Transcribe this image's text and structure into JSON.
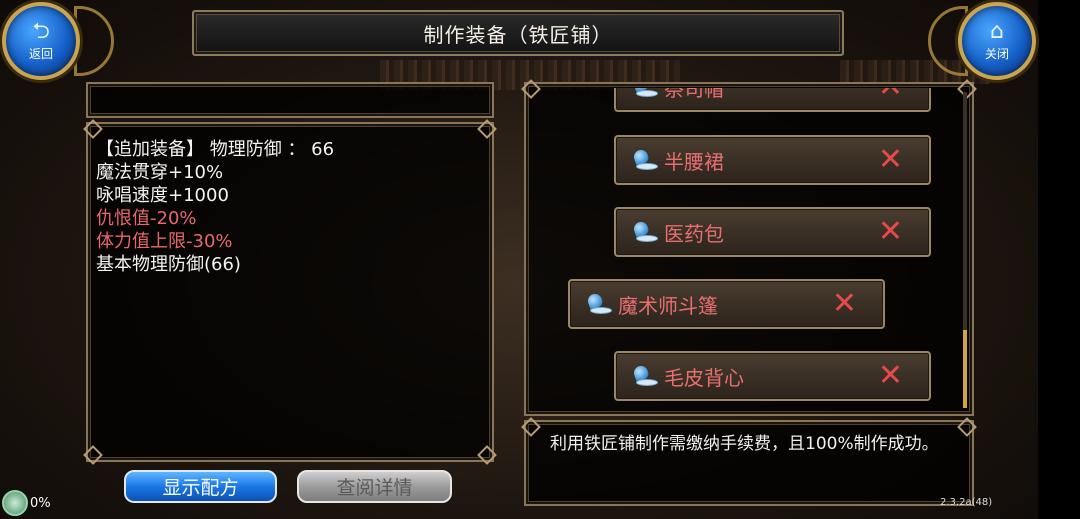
{
  "header": {
    "title": "制作装备（铁匠铺）"
  },
  "nav": {
    "back": {
      "icon": "back-arrow-icon",
      "label": "返回"
    },
    "close": {
      "icon": "home-icon",
      "label": "关闭"
    }
  },
  "equipment": {
    "stat_header": "【追加装备】 物理防御 ： 66",
    "stats": [
      {
        "text": "魔法贯穿+10%",
        "color": "#f2f2f2"
      },
      {
        "text": "咏唱速度+1000",
        "color": "#f2f2f2"
      },
      {
        "text": "仇恨值-20%",
        "color": "#e8676a"
      },
      {
        "text": "体力值上限-30%",
        "color": "#e8676a"
      },
      {
        "text": "基本物理防御(66)",
        "color": "#f2f2f2"
      }
    ]
  },
  "buttons": {
    "show_recipe": "显示配方",
    "view_details": "查阅详情"
  },
  "recipe_list": {
    "items": [
      {
        "name": "祭司帽",
        "icon": "hat-icon",
        "remove": "✕"
      },
      {
        "name": "半腰裙",
        "icon": "hat-icon",
        "remove": "✕"
      },
      {
        "name": "医药包",
        "icon": "hat-icon",
        "remove": "✕"
      },
      {
        "name": "魔术师斗篷",
        "icon": "hat-icon",
        "remove": "✕"
      },
      {
        "name": "毛皮背心",
        "icon": "hat-icon",
        "remove": "✕"
      }
    ],
    "selected_index": 3
  },
  "description": "利用铁匠铺制作需缴纳手续费，且100%制作成功。",
  "footer": {
    "progress": "0%",
    "version": "2.3.2a(48)"
  },
  "colors": {
    "accent_gold": "#c9a451",
    "stat_red": "#e8676a",
    "item_red": "#e86f6f"
  }
}
